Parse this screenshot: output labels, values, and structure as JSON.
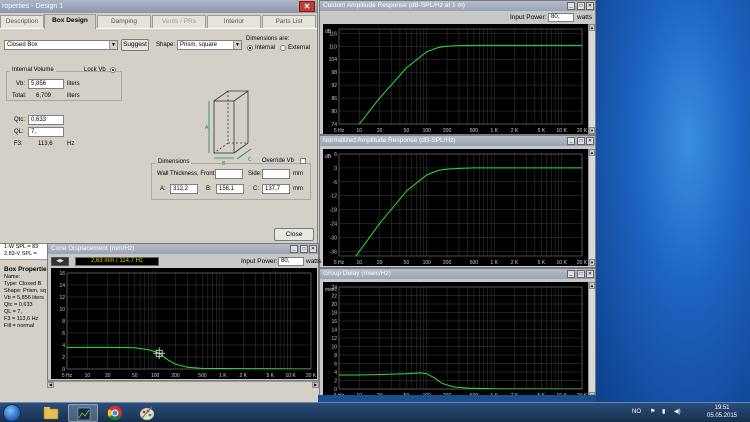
{
  "dialog": {
    "title": "roperties - Design 1",
    "close_glyph": "✕",
    "tabs": [
      {
        "label": "Description"
      },
      {
        "label": "Box Design"
      },
      {
        "label": "Damping"
      },
      {
        "label": "Vents / PRs"
      },
      {
        "label": "Interior"
      },
      {
        "label": "Parts List"
      }
    ],
    "box_type": "Closed Box",
    "suggest_label": "Suggest",
    "shape_label": "Shape:",
    "shape_value": "Prism, square",
    "dimensions_are_label": "Dimensions are:",
    "internal_label": "Internal",
    "external_label": "External",
    "internal_volume_label": "Internal Volume",
    "lock_vb_label": "Lock Vb",
    "vb_label": "Vb:",
    "vb_value": "5,856",
    "vb_unit": "liters",
    "total_label": "Total:",
    "total_value": "6,709",
    "total_unit": "liters",
    "qtc_label": "Qtc:",
    "qtc_value": "0,633",
    "ql_label": "QL:",
    "ql_value": "7,",
    "f3_label": "F3:",
    "f3_value": "113,6",
    "f3_unit": "Hz",
    "dimensions_label": "Dimensions",
    "override_vb_label": "Override Vb",
    "wall_label": "Wall Thickness, Front:",
    "side_label": "Side:",
    "mm_label": "mm",
    "a_label": "A:",
    "a_value": "312,2",
    "b_label": "B:",
    "b_value": "156,1",
    "c_label": "C:",
    "c_value": "137,7",
    "close_label": "Close",
    "diagram_letters": [
      "A",
      "B",
      "C"
    ]
  },
  "side_panel": {
    "spl_lines": [
      "1-W SPL = 83",
      "2.83-V SPL ="
    ],
    "heading": "Box Propertie",
    "lines": [
      "Name:",
      "Type: Closed B",
      "Shape: Prism, sq",
      "Vb = 5,856 liters",
      "Qtc = 0,633",
      "QL = 7,",
      "F3 = 113,6 Hz",
      "Fill = normal"
    ]
  },
  "windows": {
    "cone": {
      "title": "Cone Displacement (mm/Hz)",
      "readout": "2,63 mm / 114,7 Hz",
      "input_power_label": "Input Power:",
      "input_power_value": "80,",
      "input_power_unit": "watts"
    },
    "custom": {
      "title": "Custom Amplitude Response (dB-SPL/Hz at 1 m)",
      "input_power_label": "Input Power:",
      "input_power_value": "80,",
      "input_power_unit": "watts"
    },
    "normalized": {
      "title": "Normalized Amplitude Response (dB-SPL/Hz)"
    },
    "group_delay": {
      "title": "Group Delay (msec/Hz)"
    }
  },
  "chart_data": [
    {
      "type": "line",
      "title": "Custom Amplitude Response (dB-SPL/Hz at 1 m)",
      "ylabel": "dB",
      "ylim": [
        74,
        118
      ],
      "yticks": [
        74,
        80,
        86,
        92,
        98,
        104,
        110,
        116
      ],
      "xticks": [
        "5 Hz",
        "10",
        "20",
        "50",
        "100",
        "200",
        "500",
        "1 K",
        "2 K",
        "5 K",
        "10 K",
        "20 K"
      ],
      "x": [
        5,
        10,
        20,
        50,
        100,
        150,
        200,
        300,
        500,
        1000,
        20000
      ],
      "y": [
        62,
        74,
        86,
        100,
        107.5,
        109.5,
        110,
        110.3,
        110.4,
        110.4,
        110.4
      ],
      "color": "#30e030"
    },
    {
      "type": "line",
      "title": "Normalized Amplitude Response (dB-SPL/Hz)",
      "ylabel": "dB",
      "ylim": [
        -38,
        6
      ],
      "yticks": [
        -36,
        -30,
        -24,
        -18,
        -12,
        -6,
        0,
        6
      ],
      "xticks": [
        "5 Hz",
        "10",
        "20",
        "50",
        "100",
        "200",
        "500",
        "1 K",
        "2 K",
        "5 K",
        "10 K",
        "20 K"
      ],
      "x": [
        5,
        10,
        20,
        50,
        100,
        150,
        200,
        300,
        500,
        1000,
        20000
      ],
      "y": [
        -48,
        -36,
        -24,
        -10,
        -3,
        -1,
        -0.5,
        -0.2,
        0,
        0,
        0
      ],
      "color": "#30e030"
    },
    {
      "type": "line",
      "title": "Group Delay (msec/Hz)",
      "ylabel": "msec",
      "ylim": [
        0,
        24
      ],
      "yticks": [
        0,
        2,
        4,
        6,
        8,
        10,
        12,
        14,
        16,
        18,
        20,
        22,
        24
      ],
      "xticks": [
        "5 Hz",
        "10",
        "20",
        "50",
        "100",
        "200",
        "500",
        "1 K",
        "2 K",
        "5 K",
        "10 K",
        "20 K"
      ],
      "x": [
        5,
        10,
        20,
        50,
        80,
        100,
        130,
        170,
        250,
        400,
        1000,
        20000
      ],
      "y": [
        3.3,
        3.3,
        3.4,
        3.6,
        3.8,
        3.6,
        2.6,
        1.3,
        0.5,
        0.2,
        0.05,
        0
      ],
      "color": "#30e030"
    },
    {
      "type": "line",
      "title": "Cone Displacement (mm/Hz)",
      "ylim": [
        0,
        16
      ],
      "yticks": [
        0,
        2,
        4,
        6,
        8,
        10,
        12,
        14,
        16
      ],
      "xticks": [
        "5 Hz",
        "10",
        "20",
        "50",
        "100",
        "200",
        "500",
        "1 K",
        "2 K",
        "5 K",
        "10 K",
        "20 K"
      ],
      "x": [
        5,
        10,
        20,
        50,
        80,
        100,
        115,
        150,
        200,
        300,
        500,
        20000
      ],
      "y": [
        3.6,
        3.6,
        3.6,
        3.55,
        3.2,
        2.9,
        2.63,
        1.6,
        0.8,
        0.3,
        0.1,
        0
      ],
      "cursor": {
        "x": 114.7,
        "y": 2.63
      },
      "color": "#30e030"
    }
  ],
  "taskbar": {
    "language": "NO",
    "time": "19:51",
    "date": "05.05.2015"
  }
}
